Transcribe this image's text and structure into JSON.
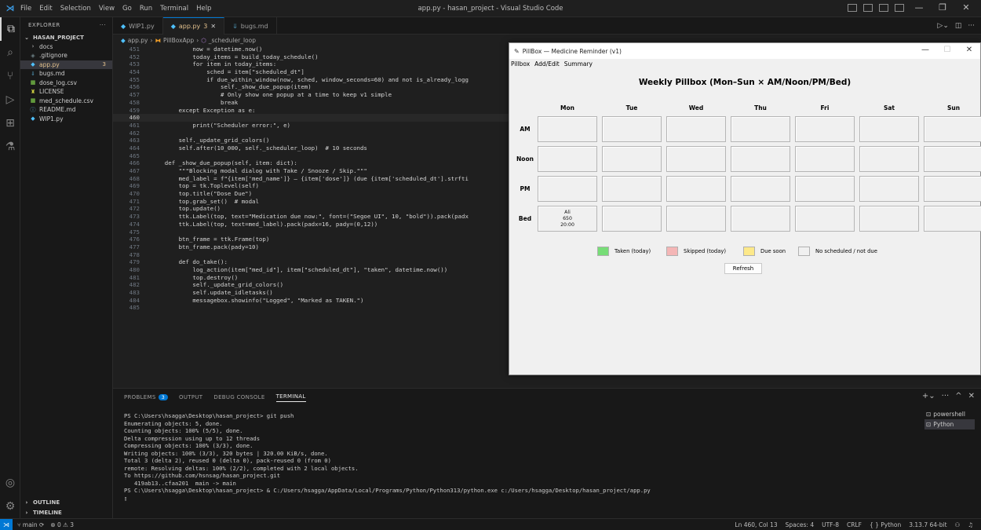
{
  "titlebar": {
    "menus": [
      "File",
      "Edit",
      "Selection",
      "View",
      "Go",
      "Run",
      "Terminal",
      "Help"
    ],
    "window_title": "app.py - hasan_project - Visual Studio Code"
  },
  "explorer": {
    "header": "EXPLORER",
    "more": "···",
    "project": "HASAN_PROJECT",
    "items": [
      {
        "name": "docs",
        "icon": "›",
        "color": "#cccccc"
      },
      {
        "name": ".gitignore",
        "icon": "◈",
        "color": "#6d8086"
      },
      {
        "name": "app.py",
        "icon": "◆",
        "color": "#4fc1ff",
        "badge": "3"
      },
      {
        "name": "bugs.md",
        "icon": "⇓",
        "color": "#519aba"
      },
      {
        "name": "dose_log.csv",
        "icon": "▦",
        "color": "#89e051"
      },
      {
        "name": "LICENSE",
        "icon": "♜",
        "color": "#cbcb41"
      },
      {
        "name": "med_schedule.csv",
        "icon": "▦",
        "color": "#89e051"
      },
      {
        "name": "README.md",
        "icon": "ⓘ",
        "color": "#519aba"
      },
      {
        "name": "WIP1.py",
        "icon": "◆",
        "color": "#4fc1ff"
      }
    ],
    "outline": "OUTLINE",
    "timeline": "TIMELINE"
  },
  "tabs": [
    {
      "label": "WIP1.py",
      "active": false
    },
    {
      "label": "app.py",
      "suffix": "3",
      "active": true
    },
    {
      "label": "bugs.md",
      "active": false
    }
  ],
  "breadcrumb": [
    "app.py",
    "PillBoxApp",
    "_scheduler_loop"
  ],
  "code": [
    {
      "n": "451",
      "t": "            now = datetime.now()"
    },
    {
      "n": "452",
      "t": "            today_items = build_today_schedule()"
    },
    {
      "n": "453",
      "t": "            for item in today_items:"
    },
    {
      "n": "454",
      "t": "                sched = item[\"scheduled_dt\"]"
    },
    {
      "n": "455",
      "t": "                if due_within_window(now, sched, window_seconds=60) and not is_already_logg"
    },
    {
      "n": "456",
      "t": "                    self._show_due_popup(item)"
    },
    {
      "n": "457",
      "t": "                    # Only show one popup at a time to keep v1 simple"
    },
    {
      "n": "458",
      "t": "                    break"
    },
    {
      "n": "459",
      "t": "        except Exception as e:"
    },
    {
      "n": "460",
      "t": "",
      "cur": true
    },
    {
      "n": "461",
      "t": "            print(\"Scheduler error:\", e)"
    },
    {
      "n": "462",
      "t": ""
    },
    {
      "n": "463",
      "t": "        self._update_grid_colors()"
    },
    {
      "n": "464",
      "t": "        self.after(10_000, self._scheduler_loop)  # 10 seconds"
    },
    {
      "n": "465",
      "t": ""
    },
    {
      "n": "466",
      "t": "    def _show_due_popup(self, item: dict):"
    },
    {
      "n": "467",
      "t": "        \"\"\"Blocking modal dialog with Take / Snooze / Skip.\"\"\""
    },
    {
      "n": "468",
      "t": "        med_label = f\"{item['med_name']} — {item['dose']} (due {item['scheduled_dt'].strfti"
    },
    {
      "n": "469",
      "t": "        top = tk.Toplevel(self)"
    },
    {
      "n": "470",
      "t": "        top.title(\"Dose Due\")"
    },
    {
      "n": "471",
      "t": "        top.grab_set()  # modal"
    },
    {
      "n": "472",
      "t": "        top.update()"
    },
    {
      "n": "473",
      "t": "        ttk.Label(top, text=\"Medication due now:\", font=(\"Segoe UI\", 10, \"bold\")).pack(padx"
    },
    {
      "n": "474",
      "t": "        ttk.Label(top, text=med_label).pack(padx=16, pady=(0,12))"
    },
    {
      "n": "475",
      "t": ""
    },
    {
      "n": "476",
      "t": "        btn_frame = ttk.Frame(top)"
    },
    {
      "n": "477",
      "t": "        btn_frame.pack(pady=10)"
    },
    {
      "n": "478",
      "t": ""
    },
    {
      "n": "479",
      "t": "        def do_take():"
    },
    {
      "n": "480",
      "t": "            log_action(item[\"med_id\"], item[\"scheduled_dt\"], \"taken\", datetime.now())"
    },
    {
      "n": "481",
      "t": "            top.destroy()"
    },
    {
      "n": "482",
      "t": "            self._update_grid_colors()"
    },
    {
      "n": "483",
      "t": "            self.update_idletasks()"
    },
    {
      "n": "484",
      "t": "            messagebox.showinfo(\"Logged\", \"Marked as TAKEN.\")"
    },
    {
      "n": "485",
      "t": ""
    }
  ],
  "panel": {
    "tabs": [
      "PROBLEMS",
      "OUTPUT",
      "DEBUG CONSOLE",
      "TERMINAL"
    ],
    "problems_count": "3",
    "terminal_lines": [
      "PS C:\\Users\\hsagga\\Desktop\\hasan_project> git push",
      "Enumerating objects: 5, done.",
      "Counting objects: 100% (5/5), done.",
      "Delta compression using up to 12 threads",
      "Compressing objects: 100% (3/3), done.",
      "Writing objects: 100% (3/3), 320 bytes | 320.00 KiB/s, done.",
      "Total 3 (delta 2), reused 0 (delta 0), pack-reused 0 (from 0)",
      "remote: Resolving deltas: 100% (2/2), completed with 2 local objects.",
      "To https://github.com/hsnsag/hasan_project.git",
      "   419ab13..cfaa201  main -> main",
      "PS C:\\Users\\hsagga\\Desktop\\hasan_project> & C:/Users/hsagga/AppData/Local/Programs/Python/Python313/python.exe c:/Users/hsagga/Desktop/hasan_project/app.py",
      "▯"
    ],
    "terminals": [
      {
        "label": "powershell",
        "selected": false
      },
      {
        "label": "Python",
        "selected": true
      }
    ]
  },
  "statusbar": {
    "branch": "main",
    "sync": "⟳",
    "problems": "⊗ 0 ⚠ 3",
    "position": "Ln 460, Col 13",
    "spaces": "Spaces: 4",
    "encoding": "UTF-8",
    "eol": "CRLF",
    "language": "Python",
    "interpreter": "3.13.7 64-bit"
  },
  "pillbox": {
    "window_title": "PillBox — Medicine Reminder (v1)",
    "menu": [
      "Pillbox",
      "Add/Edit",
      "Summary"
    ],
    "heading": "Weekly Pillbox (Mon–Sun × AM/Noon/PM/Bed)",
    "days": [
      "Mon",
      "Tue",
      "Wed",
      "Thu",
      "Fri",
      "Sat",
      "Sun"
    ],
    "slots": [
      "AM",
      "Noon",
      "PM",
      "Bed"
    ],
    "entries": {
      "Bed-Mon": [
        "Ali",
        "650",
        "20:00"
      ]
    },
    "legend": [
      {
        "label": "Taken (today)",
        "color": "#77dd77"
      },
      {
        "label": "Skipped (today)",
        "color": "#f4b6b6"
      },
      {
        "label": "Due soon",
        "color": "#fde98a"
      },
      {
        "label": "No scheduled / not due",
        "color": "#f0f0f0"
      }
    ],
    "refresh_label": "Refresh"
  }
}
